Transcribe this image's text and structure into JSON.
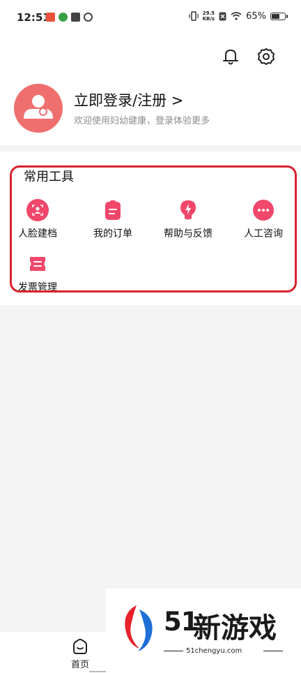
{
  "status_bar": {
    "time": "12:51",
    "net_speed_value": "29.5",
    "net_speed_unit": "KB/s",
    "battery_percent": "65%",
    "battery_level": 0.65
  },
  "header": {
    "login_title": "立即登录/注册 >",
    "login_subtitle": "欢迎使用妇幼健康，登录体验更多"
  },
  "tools": {
    "title": "常用工具",
    "items": [
      {
        "label": "人脸建档",
        "icon": "face-scan-icon"
      },
      {
        "label": "我的订单",
        "icon": "order-clipboard-icon"
      },
      {
        "label": "帮助与反馈",
        "icon": "lightning-bulb-icon"
      },
      {
        "label": "人工咨询",
        "icon": "chat-bubble-icon"
      },
      {
        "label": "发票管理",
        "icon": "ticket-icon"
      }
    ],
    "accent_color": "#f0476a"
  },
  "bottom_nav": {
    "home_label": "首页"
  },
  "watermark": {
    "number": "51",
    "text": "新游戏",
    "url": "51chengyu.com"
  }
}
